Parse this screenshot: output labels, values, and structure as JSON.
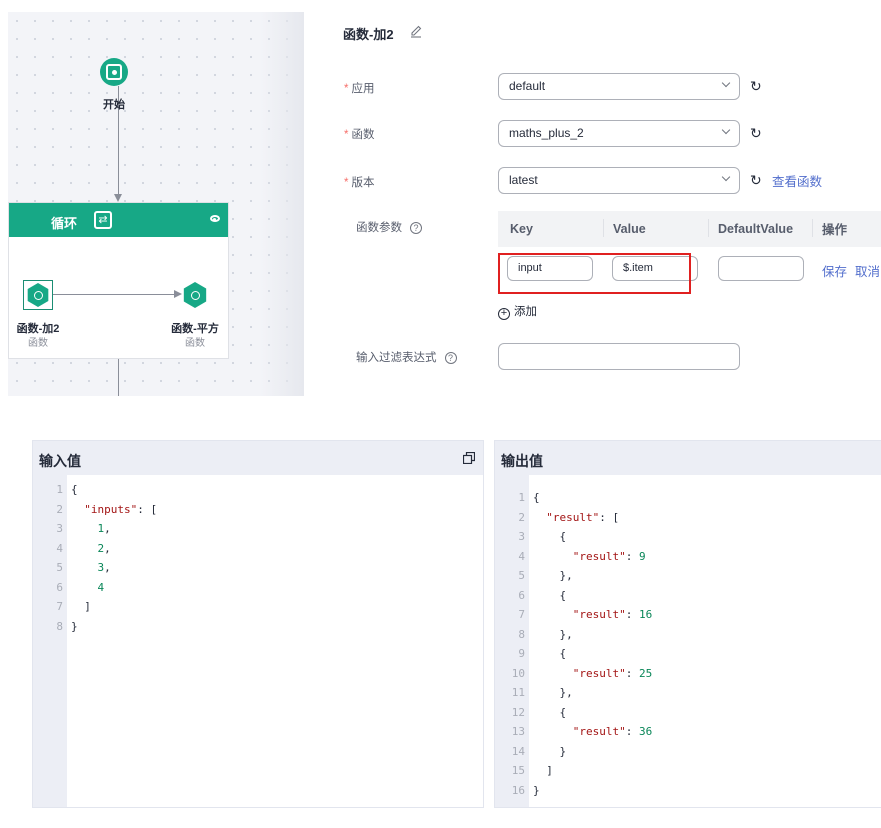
{
  "canvas": {
    "start_label": "开始",
    "loop_title": "循环",
    "node_add": {
      "label": "函数-加2",
      "sub": "函数"
    },
    "node_square": {
      "label": "函数-平方",
      "sub": "函数"
    }
  },
  "form": {
    "title": "函数-加2",
    "app": {
      "label": "应用",
      "value": "default"
    },
    "func": {
      "label": "函数",
      "value": "maths_plus_2"
    },
    "version": {
      "label": "版本",
      "value": "latest",
      "link": "查看函数"
    },
    "params": {
      "label": "函数参数",
      "headers": [
        "Key",
        "Value",
        "DefaultValue",
        "操作"
      ],
      "row": {
        "key": "input",
        "value": "$.item",
        "default": ""
      },
      "actions": [
        "保存",
        "取消"
      ]
    },
    "add_label": "添加",
    "filter_label": "输入过滤表达式",
    "filter_value": ""
  },
  "input_panel": {
    "title": "输入值",
    "lines": [
      "{",
      "  \"inputs\": [",
      "    1,",
      "    2,",
      "    3,",
      "    4",
      "  ]",
      "}"
    ]
  },
  "output_panel": {
    "title": "输出值",
    "lines": [
      "{",
      "  \"result\": [",
      "    {",
      "      \"result\": 9",
      "    },",
      "    {",
      "      \"result\": 16",
      "    },",
      "    {",
      "      \"result\": 25",
      "    },",
      "    {",
      "      \"result\": 36",
      "    }",
      "  ]",
      "}"
    ]
  },
  "colors": {
    "accent": "#17a886",
    "link": "#526ecc",
    "highlight": "#e02020",
    "required": "#f66f6a"
  }
}
